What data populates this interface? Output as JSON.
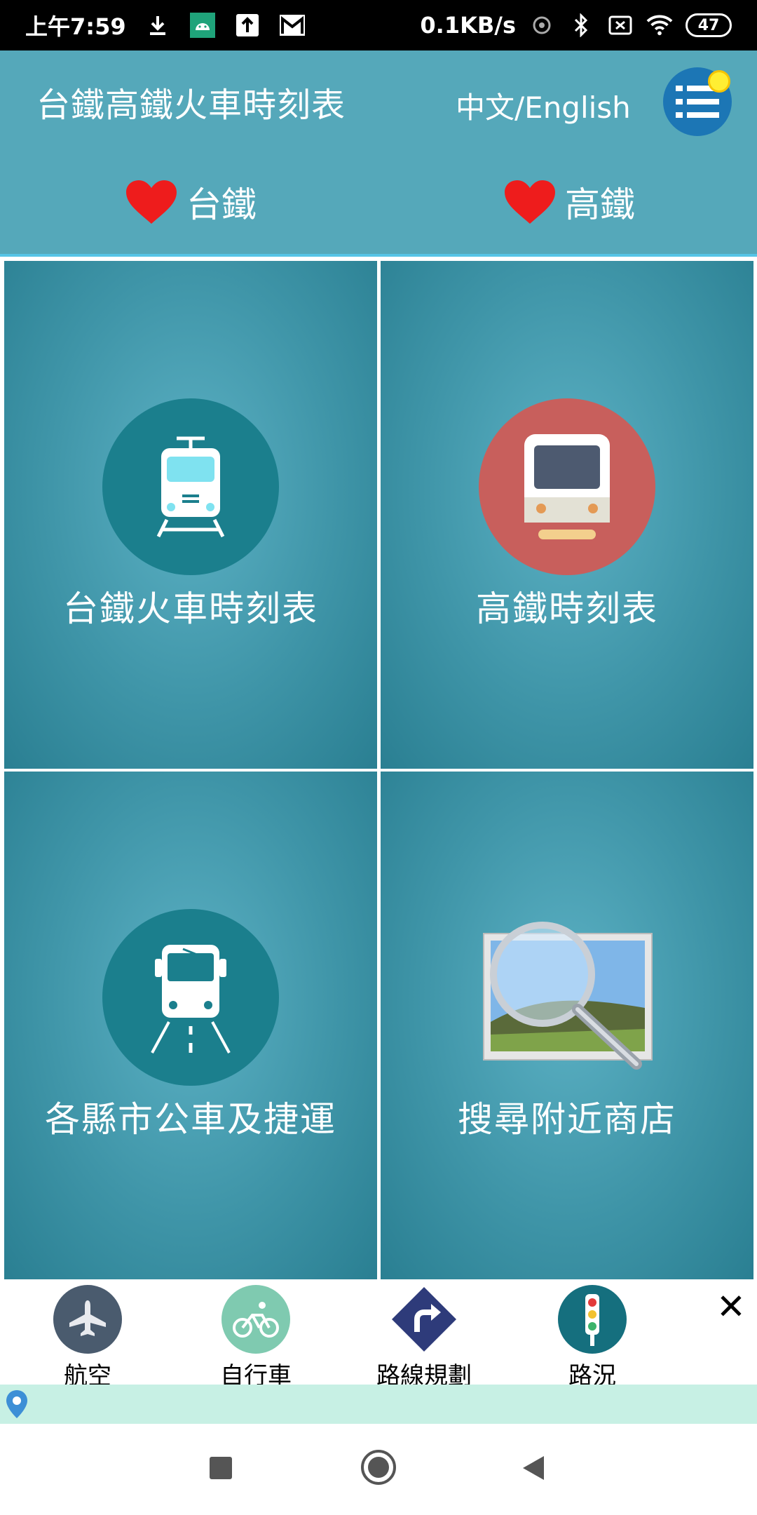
{
  "status_bar": {
    "time": "上午7:59",
    "net_speed": "0.1KB/s",
    "battery": "47"
  },
  "header": {
    "title": "台鐵高鐵火車時刻表",
    "lang_toggle": "中文/English",
    "favorites": [
      {
        "label": "台鐵"
      },
      {
        "label": "高鐵"
      }
    ]
  },
  "tiles": [
    {
      "label": "台鐵火車時刻表",
      "icon": "train-icon",
      "icon_bg": "#1b7f8d"
    },
    {
      "label": "高鐵時刻表",
      "icon": "hsr-train-icon",
      "icon_bg": "#c85f5c"
    },
    {
      "label": "各縣市公車及捷運",
      "icon": "bus-icon",
      "icon_bg": "#1b7f8d"
    },
    {
      "label": "搜尋附近商店",
      "icon": "magnifier-photo-icon",
      "icon_bg": "transparent"
    }
  ],
  "quickbar": {
    "items": [
      {
        "label": "航空",
        "icon": "airplane-icon",
        "color": "#4a5b6e"
      },
      {
        "label": "自行車",
        "icon": "bicycle-icon",
        "color": "#7fcab0"
      },
      {
        "label": "路線規劃",
        "icon": "route-icon",
        "color": "#2e3b7a"
      },
      {
        "label": "路況",
        "icon": "traffic-light-icon",
        "color": "#156f7e"
      }
    ],
    "close_label": "✕"
  },
  "colors": {
    "header_bg": "#55a8ba",
    "tile_bg": "#3f95a8",
    "heart": "#ee1c1c",
    "menu_btn": "#1c76b5"
  }
}
